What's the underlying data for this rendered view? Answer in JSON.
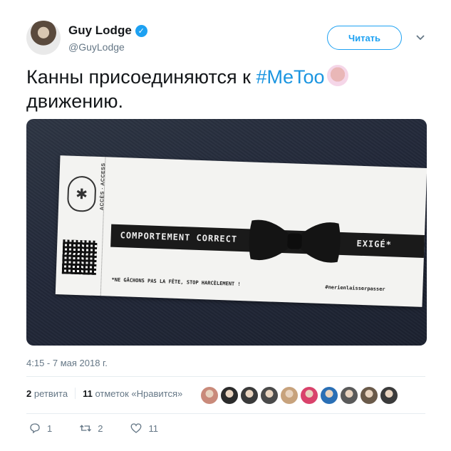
{
  "author": {
    "name": "Guy Lodge",
    "handle": "@GuyLodge",
    "verified_mark": "✓"
  },
  "follow_button_label": "Читать",
  "tweet": {
    "text_before": "Канны присоединяются к ",
    "hashtag": "#MeToo",
    "text_after": "движению.",
    "emoji": "raised-hands-emoji"
  },
  "photo": {
    "acces_label": "ACCÈS · ACCESS",
    "band_left": "COMPORTEMENT CORRECT",
    "band_right": "EXIGÉ*",
    "foot_left": "*NE GÂCHONS PAS LA FÊTE, STOP HARCÈLEMENT !",
    "foot_right": "#nerienlaisserpasser"
  },
  "timestamp": "4:15 - 7 мая 2018 г.",
  "stats": {
    "retweets_count": "2",
    "retweets_label": "ретвита",
    "likes_count": "11",
    "likes_label": "отметок «Нравится»"
  },
  "liker_avatar_colors": [
    "#c98a7a",
    "#2b2b2b",
    "#3a3a3a",
    "#4a4a4a",
    "#c7a27c",
    "#d9436b",
    "#2a6fb5",
    "#5a5a5a",
    "#6a5a4a",
    "#3b3b3b"
  ],
  "actions": {
    "reply_count": "1",
    "retweet_count": "2",
    "like_count": "11"
  },
  "colors": {
    "accent": "#1da1f2",
    "hashtag": "#1b95e0",
    "muted": "#657786"
  }
}
